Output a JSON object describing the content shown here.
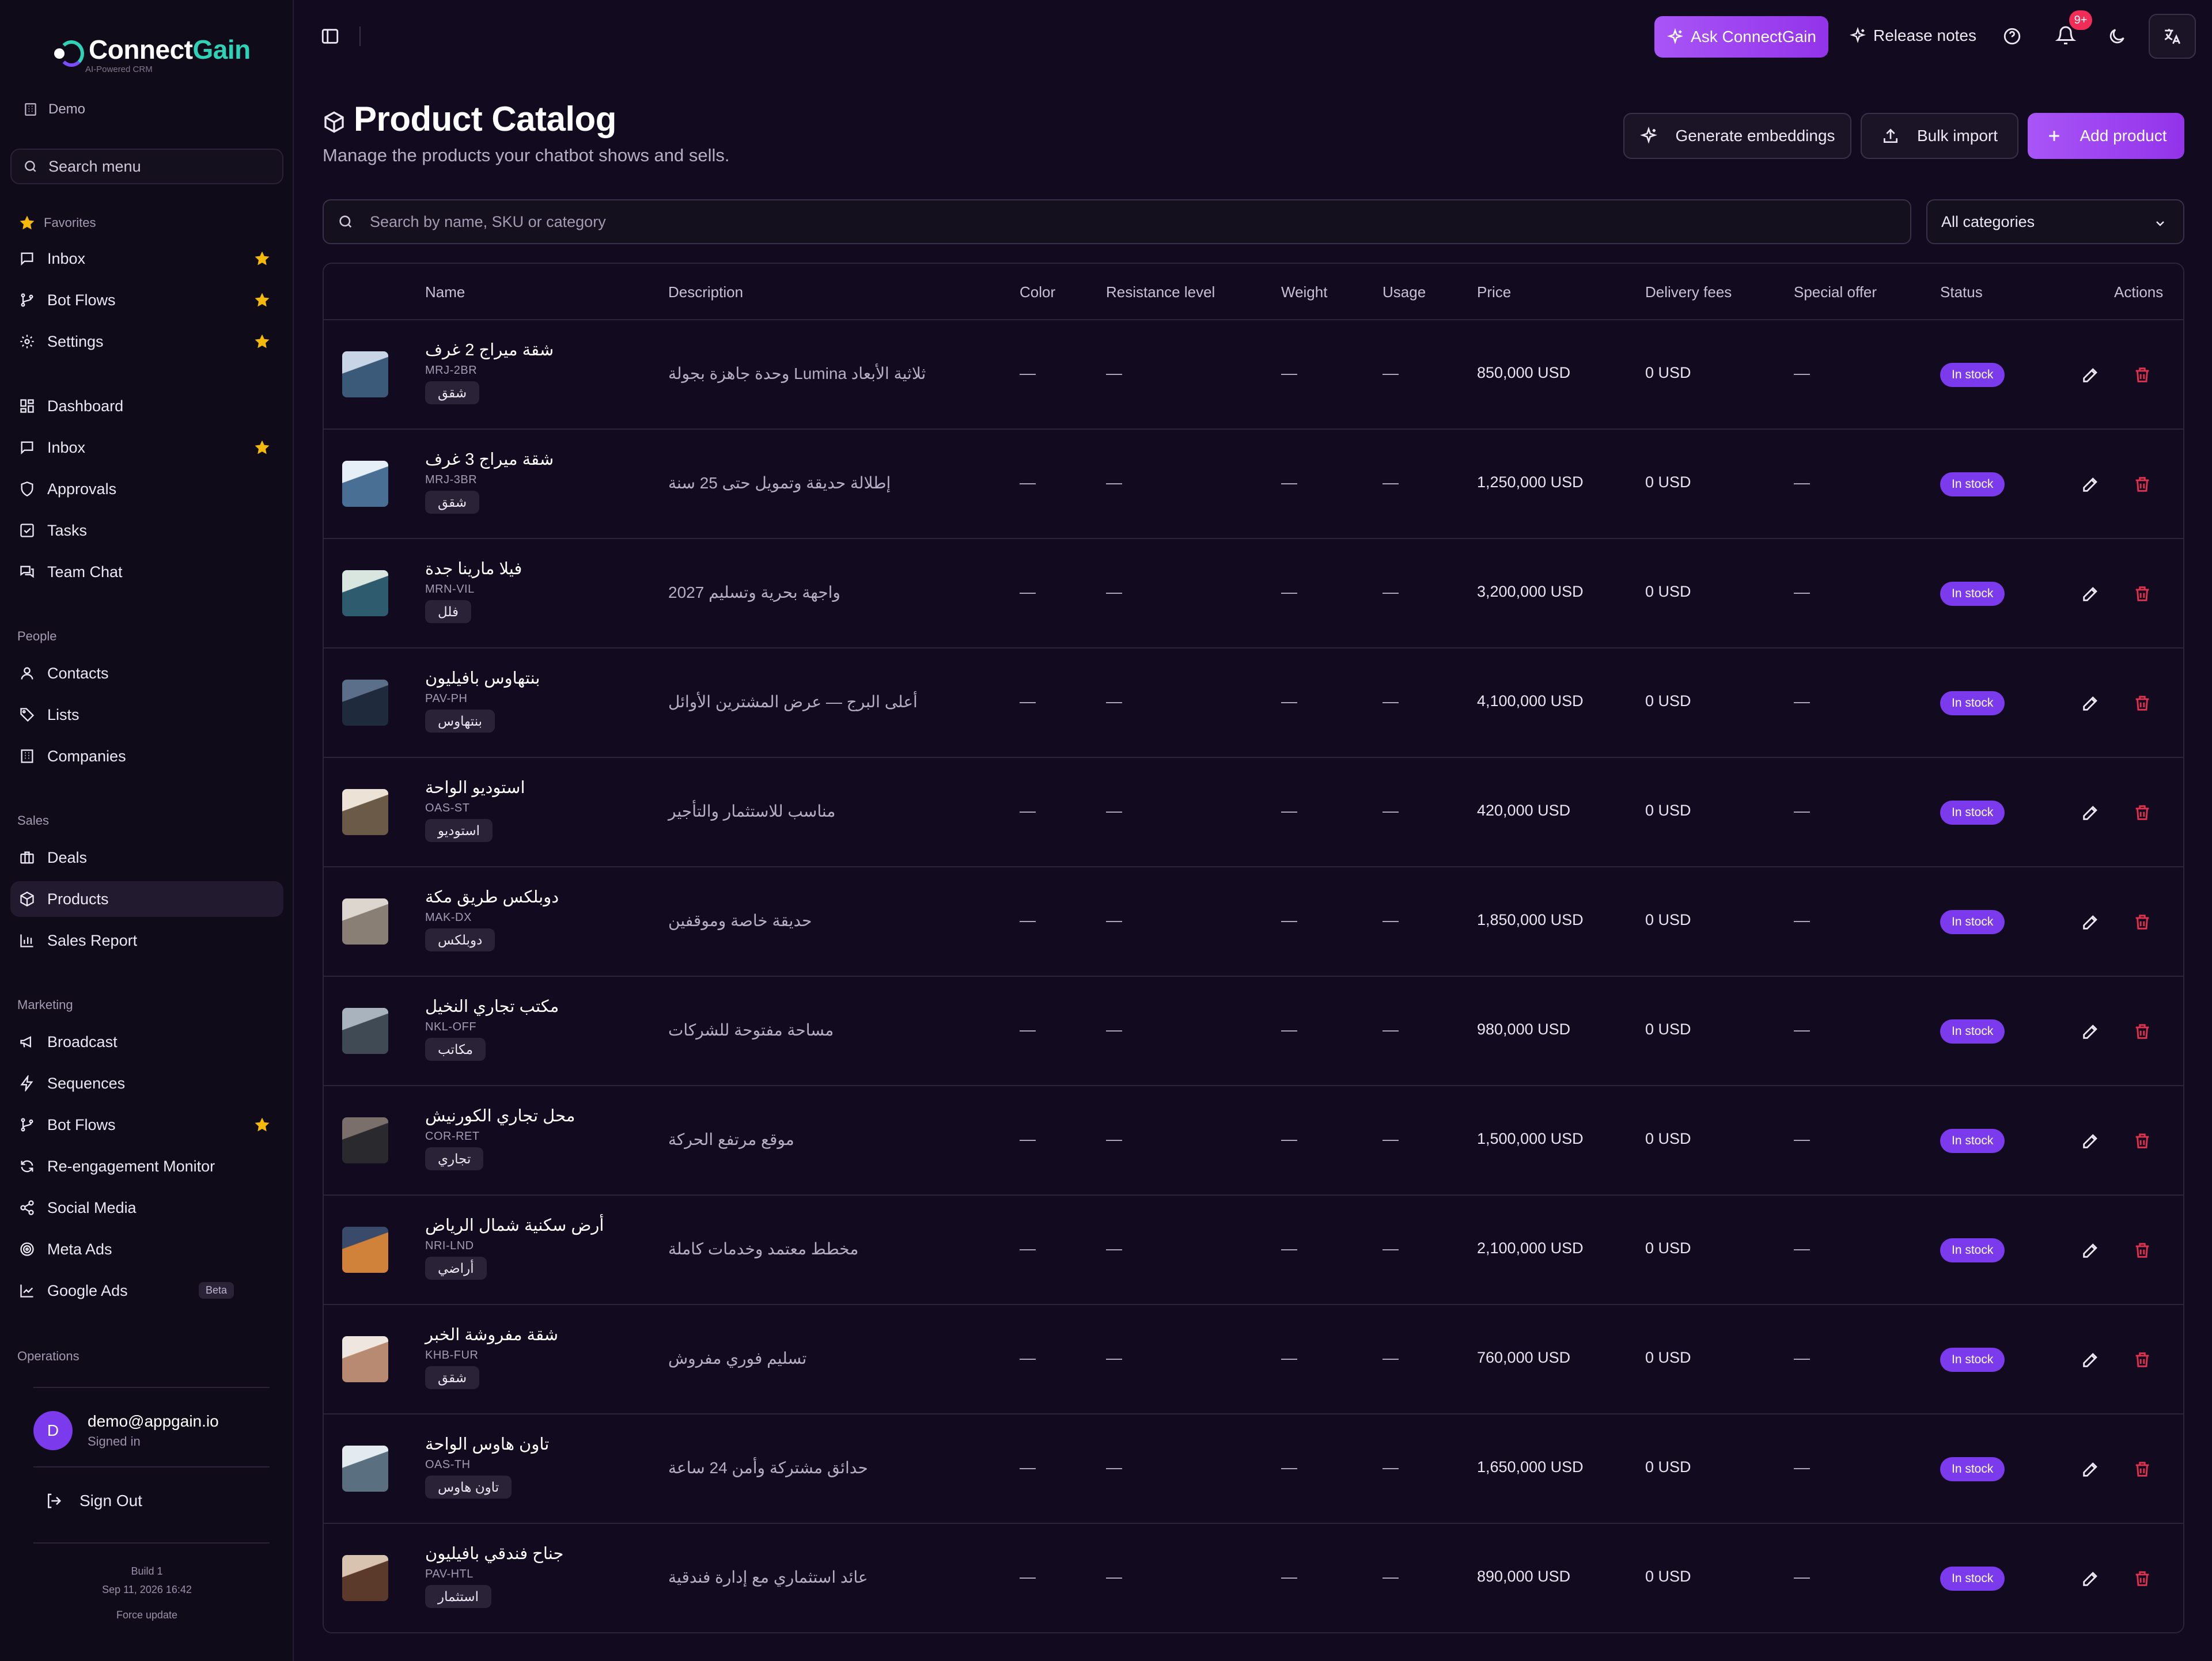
{
  "brand": {
    "name_a": "Connect",
    "name_b": "Gain",
    "tagline": "AI-Powered CRM",
    "accent": "#2ed3b7",
    "primary": "#9333ea"
  },
  "workspace": "Demo",
  "sidebar": {
    "search_placeholder": "Search menu",
    "favorites_label": "Favorites",
    "favorites": [
      {
        "label": "Inbox",
        "icon": "message-icon"
      },
      {
        "label": "Bot Flows",
        "icon": "git-branch-icon"
      },
      {
        "label": "Settings",
        "icon": "gear-icon"
      }
    ],
    "main": [
      {
        "label": "Dashboard",
        "icon": "dashboard-icon"
      },
      {
        "label": "Inbox",
        "icon": "message-icon"
      },
      {
        "label": "Approvals",
        "icon": "shield-icon"
      },
      {
        "label": "Tasks",
        "icon": "checkbox-icon"
      },
      {
        "label": "Team Chat",
        "icon": "chat-icon"
      }
    ],
    "people_label": "People",
    "people": [
      {
        "label": "Contacts",
        "icon": "user-icon"
      },
      {
        "label": "Lists",
        "icon": "tag-icon"
      },
      {
        "label": "Companies",
        "icon": "building-icon"
      }
    ],
    "sales_label": "Sales",
    "sales": [
      {
        "label": "Deals",
        "icon": "briefcase-icon"
      },
      {
        "label": "Products",
        "icon": "box-icon"
      },
      {
        "label": "Sales Report",
        "icon": "bar-chart-icon"
      }
    ],
    "marketing_label": "Marketing",
    "marketing": [
      {
        "label": "Broadcast",
        "icon": "megaphone-icon"
      },
      {
        "label": "Sequences",
        "icon": "zap-icon"
      },
      {
        "label": "Bot Flows",
        "icon": "git-branch-icon"
      },
      {
        "label": "Re-engagement Monitor",
        "icon": "refresh-icon"
      },
      {
        "label": "Social Media",
        "icon": "share-icon"
      },
      {
        "label": "Meta Ads",
        "icon": "target-icon"
      },
      {
        "label": "Google Ads",
        "icon": "trend-icon"
      }
    ],
    "beta_label": "Beta",
    "operations_label": "Operations",
    "user": {
      "initial": "D",
      "email": "demo@appgain.io",
      "status": "Signed in"
    },
    "sign_out": "Sign Out",
    "build": "Build 1",
    "build_date": "Sep 11, 2026 16:42",
    "force_update": "Force update"
  },
  "topbar": {
    "ask": "Ask ConnectGain",
    "release_notes": "Release notes",
    "notifications_count": "9+"
  },
  "header": {
    "title": "Product Catalog",
    "subtitle": "Manage the products your chatbot shows and sells.",
    "generate": "Generate embeddings",
    "bulk_import": "Bulk import",
    "add_product": "Add product"
  },
  "filters": {
    "search_placeholder": "Search by name, SKU or category",
    "category": "All categories"
  },
  "table": {
    "columns": [
      "Name",
      "Description",
      "Color",
      "Resistance level",
      "Weight",
      "Usage",
      "Price",
      "Delivery fees",
      "Special offer",
      "Status",
      "Actions"
    ],
    "rows": [
      {
        "name": "شقة ميراج 2 غرف",
        "sku": "MRJ-2BR",
        "tag": "شقق",
        "description": "ثلاثية الأبعاد Lumina وحدة جاهزة بجولة",
        "color": "—",
        "resistance": "—",
        "weight": "—",
        "usage": "—",
        "price": "850,000 USD",
        "delivery": "0 USD",
        "offer": "—",
        "status": "In stock"
      },
      {
        "name": "شقة ميراج 3 غرف",
        "sku": "MRJ-3BR",
        "tag": "شقق",
        "description": "إطلالة حديقة وتمويل حتى 25 سنة",
        "color": "—",
        "resistance": "—",
        "weight": "—",
        "usage": "—",
        "price": "1,250,000 USD",
        "delivery": "0 USD",
        "offer": "—",
        "status": "In stock"
      },
      {
        "name": "فيلا مارينا جدة",
        "sku": "MRN-VIL",
        "tag": "فلل",
        "description": "واجهة بحرية وتسليم 2027",
        "color": "—",
        "resistance": "—",
        "weight": "—",
        "usage": "—",
        "price": "3,200,000 USD",
        "delivery": "0 USD",
        "offer": "—",
        "status": "In stock"
      },
      {
        "name": "بنتهاوس بافيليون",
        "sku": "PAV-PH",
        "tag": "بنتهاوس",
        "description": "أعلى البرج — عرض المشترين الأوائل",
        "color": "—",
        "resistance": "—",
        "weight": "—",
        "usage": "—",
        "price": "4,100,000 USD",
        "delivery": "0 USD",
        "offer": "—",
        "status": "In stock"
      },
      {
        "name": "استوديو الواحة",
        "sku": "OAS-ST",
        "tag": "استوديو",
        "description": "مناسب للاستثمار والتأجير",
        "color": "—",
        "resistance": "—",
        "weight": "—",
        "usage": "—",
        "price": "420,000 USD",
        "delivery": "0 USD",
        "offer": "—",
        "status": "In stock"
      },
      {
        "name": "دوبلكس طريق مكة",
        "sku": "MAK-DX",
        "tag": "دوبلكس",
        "description": "حديقة خاصة وموقفين",
        "color": "—",
        "resistance": "—",
        "weight": "—",
        "usage": "—",
        "price": "1,850,000 USD",
        "delivery": "0 USD",
        "offer": "—",
        "status": "In stock"
      },
      {
        "name": "مكتب تجاري النخيل",
        "sku": "NKL-OFF",
        "tag": "مكاتب",
        "description": "مساحة مفتوحة للشركات",
        "color": "—",
        "resistance": "—",
        "weight": "—",
        "usage": "—",
        "price": "980,000 USD",
        "delivery": "0 USD",
        "offer": "—",
        "status": "In stock"
      },
      {
        "name": "محل تجاري الكورنيش",
        "sku": "COR-RET",
        "tag": "تجاري",
        "description": "موقع مرتفع الحركة",
        "color": "—",
        "resistance": "—",
        "weight": "—",
        "usage": "—",
        "price": "1,500,000 USD",
        "delivery": "0 USD",
        "offer": "—",
        "status": "In stock"
      },
      {
        "name": "أرض سكنية شمال الرياض",
        "sku": "NRI-LND",
        "tag": "أراضي",
        "description": "مخطط معتمد وخدمات كاملة",
        "color": "—",
        "resistance": "—",
        "weight": "—",
        "usage": "—",
        "price": "2,100,000 USD",
        "delivery": "0 USD",
        "offer": "—",
        "status": "In stock"
      },
      {
        "name": "شقة مفروشة الخبر",
        "sku": "KHB-FUR",
        "tag": "شقق",
        "description": "تسليم فوري مفروش",
        "color": "—",
        "resistance": "—",
        "weight": "—",
        "usage": "—",
        "price": "760,000 USD",
        "delivery": "0 USD",
        "offer": "—",
        "status": "In stock"
      },
      {
        "name": "تاون هاوس الواحة",
        "sku": "OAS-TH",
        "tag": "تاون هاوس",
        "description": "حدائق مشتركة وأمن 24 ساعة",
        "color": "—",
        "resistance": "—",
        "weight": "—",
        "usage": "—",
        "price": "1,650,000 USD",
        "delivery": "0 USD",
        "offer": "—",
        "status": "In stock"
      },
      {
        "name": "جناح فندقي بافيليون",
        "sku": "PAV-HTL",
        "tag": "استثمار",
        "description": "عائد استثماري مع إدارة فندقية",
        "color": "—",
        "resistance": "—",
        "weight": "—",
        "usage": "—",
        "price": "890,000 USD",
        "delivery": "0 USD",
        "offer": "—",
        "status": "In stock"
      }
    ]
  }
}
